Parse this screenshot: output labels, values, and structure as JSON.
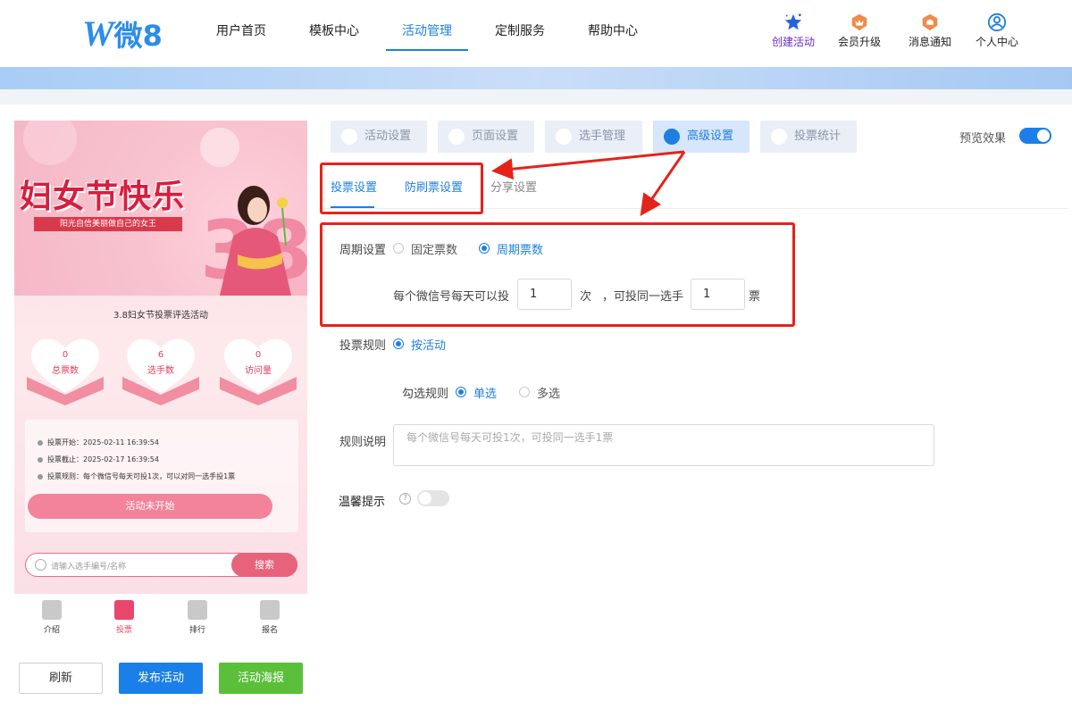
{
  "logo": {
    "mark": "W",
    "text": "微8"
  },
  "nav": {
    "items": [
      {
        "label": "用户首页"
      },
      {
        "label": "模板中心"
      },
      {
        "label": "活动管理"
      },
      {
        "label": "定制服务"
      },
      {
        "label": "帮助中心"
      }
    ],
    "active_index": 2
  },
  "toolbar": {
    "create": "创建活动",
    "upgrade": "会员升级",
    "notice": "消息通知",
    "profile": "个人中心"
  },
  "preview": {
    "hero_title": "妇女节快乐",
    "hero_sub": "阳光自信美丽做自己的女王",
    "activity_title": "3.8妇女节投票评选活动",
    "stats": [
      {
        "value": "0",
        "label": "总票数"
      },
      {
        "value": "6",
        "label": "选手数"
      },
      {
        "value": "0",
        "label": "访问量"
      }
    ],
    "info": [
      "投票开始：2025-02-11 16:39:54",
      "投票截止：2025-02-17 16:39:54",
      "投票规则：每个微信号每天可投1次，可以对同一选手投1票"
    ],
    "status_button": "活动未开始",
    "search_placeholder": "请输入选手编号/名称",
    "search_button": "搜索",
    "tabs": [
      {
        "label": "介绍"
      },
      {
        "label": "投票"
      },
      {
        "label": "排行"
      },
      {
        "label": "报名"
      }
    ],
    "active_tab": 1
  },
  "actions": {
    "refresh": "刷新",
    "publish": "发布活动",
    "poster": "活动海报"
  },
  "steps": {
    "items": [
      {
        "label": "活动设置"
      },
      {
        "label": "页面设置"
      },
      {
        "label": "选手管理"
      },
      {
        "label": "高级设置"
      },
      {
        "label": "投票统计"
      }
    ],
    "active_index": 3,
    "preview_label": "预览效果",
    "preview_on": true
  },
  "subtabs": {
    "items": [
      {
        "label": "投票设置"
      },
      {
        "label": "防刷票设置"
      },
      {
        "label": "分享设置"
      }
    ],
    "active_index": 0
  },
  "form": {
    "period_label": "周期设置",
    "period_options": [
      "固定票数",
      "周期票数"
    ],
    "period_selected": "周期票数",
    "per_user_prefix": "每个微信号每天可以投",
    "per_user_value": "1",
    "per_user_unit": "次",
    "same_player_prefix": "，可投同一选手",
    "same_player_value": "1",
    "same_player_unit": "票",
    "rule_label": "投票规则",
    "rule_option": "按活动",
    "select_rule_label": "勾选规则",
    "select_options": [
      "单选",
      "多选"
    ],
    "select_selected": "单选",
    "desc_label": "规则说明",
    "desc_placeholder": "每个微信号每天可投1次，可投同一选手1票",
    "tip_label": "温馨提示",
    "tip_on": false
  },
  "colors": {
    "accent": "#1e7fe0",
    "annotation": "#e5231b",
    "publish": "#1a7fe8",
    "poster": "#5bbf3a",
    "pink": "#e8627c"
  }
}
